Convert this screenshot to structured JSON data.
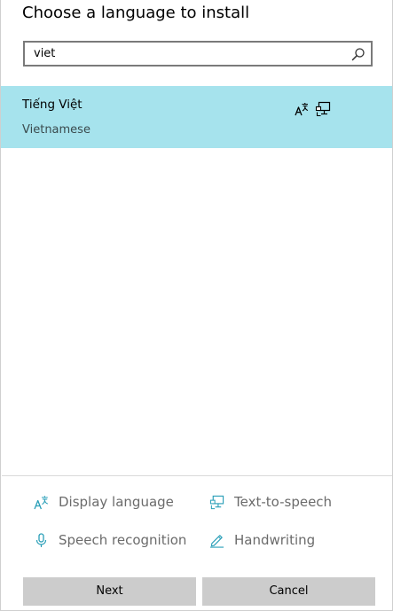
{
  "dialog": {
    "title": "Choose a language to install"
  },
  "search": {
    "value": "viet"
  },
  "results": [
    {
      "native_name": "Tiếng Việt",
      "english_name": "Vietnamese"
    }
  ],
  "legend": {
    "display_language": "Display language",
    "text_to_speech": "Text-to-speech",
    "speech_recognition": "Speech recognition",
    "handwriting": "Handwriting"
  },
  "buttons": {
    "next": "Next",
    "cancel": "Cancel"
  },
  "icons": {
    "search": "search-icon",
    "display_language": "display-language-icon",
    "text_to_speech": "text-to-speech-icon",
    "speech_recognition": "microphone-icon",
    "handwriting": "handwriting-icon"
  },
  "colors": {
    "selected_row": "#a6e3ed",
    "feature_icon": "#2a9fb8",
    "button_bg": "#cccccc",
    "legend_text": "#6b6b6b"
  }
}
